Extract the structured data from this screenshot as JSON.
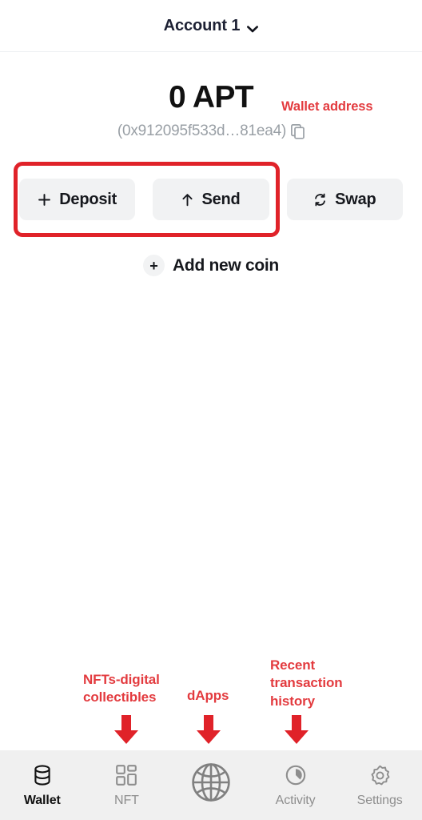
{
  "header": {
    "account_label": "Account 1",
    "chevron_icon": "chevron-down-icon"
  },
  "balance": {
    "amount": "0 APT",
    "address": "(0x912095f533d…81ea4)",
    "copy_icon": "copy-icon"
  },
  "actions": [
    {
      "label": "Deposit",
      "glyph": "+",
      "icon": "plus-icon"
    },
    {
      "label": "Send",
      "glyph": "↑",
      "icon": "arrow-up-icon"
    },
    {
      "label": "Swap",
      "glyph": "↻",
      "icon": "swap-icon"
    }
  ],
  "add_coin": {
    "label": "Add new coin",
    "glyph": "+",
    "icon": "plus-circle-icon"
  },
  "annotations": {
    "accent_color": "#e33b3f",
    "box_color": "#e02229",
    "wallet_address": "Wallet address",
    "nft": "NFTs-digital collectibles",
    "dapps": "dApps",
    "activity": "Recent transaction history",
    "arrow_icon": "arrow-down-icon"
  },
  "bottom_nav": {
    "items": [
      {
        "label": "Wallet",
        "icon": "database-icon",
        "active": true
      },
      {
        "label": "NFT",
        "icon": "grid-icon",
        "active": false
      },
      {
        "label": "",
        "icon": "globe-icon",
        "active": false
      },
      {
        "label": "Activity",
        "icon": "clock-icon",
        "active": false
      },
      {
        "label": "Settings",
        "icon": "gear-icon",
        "active": false
      }
    ]
  }
}
